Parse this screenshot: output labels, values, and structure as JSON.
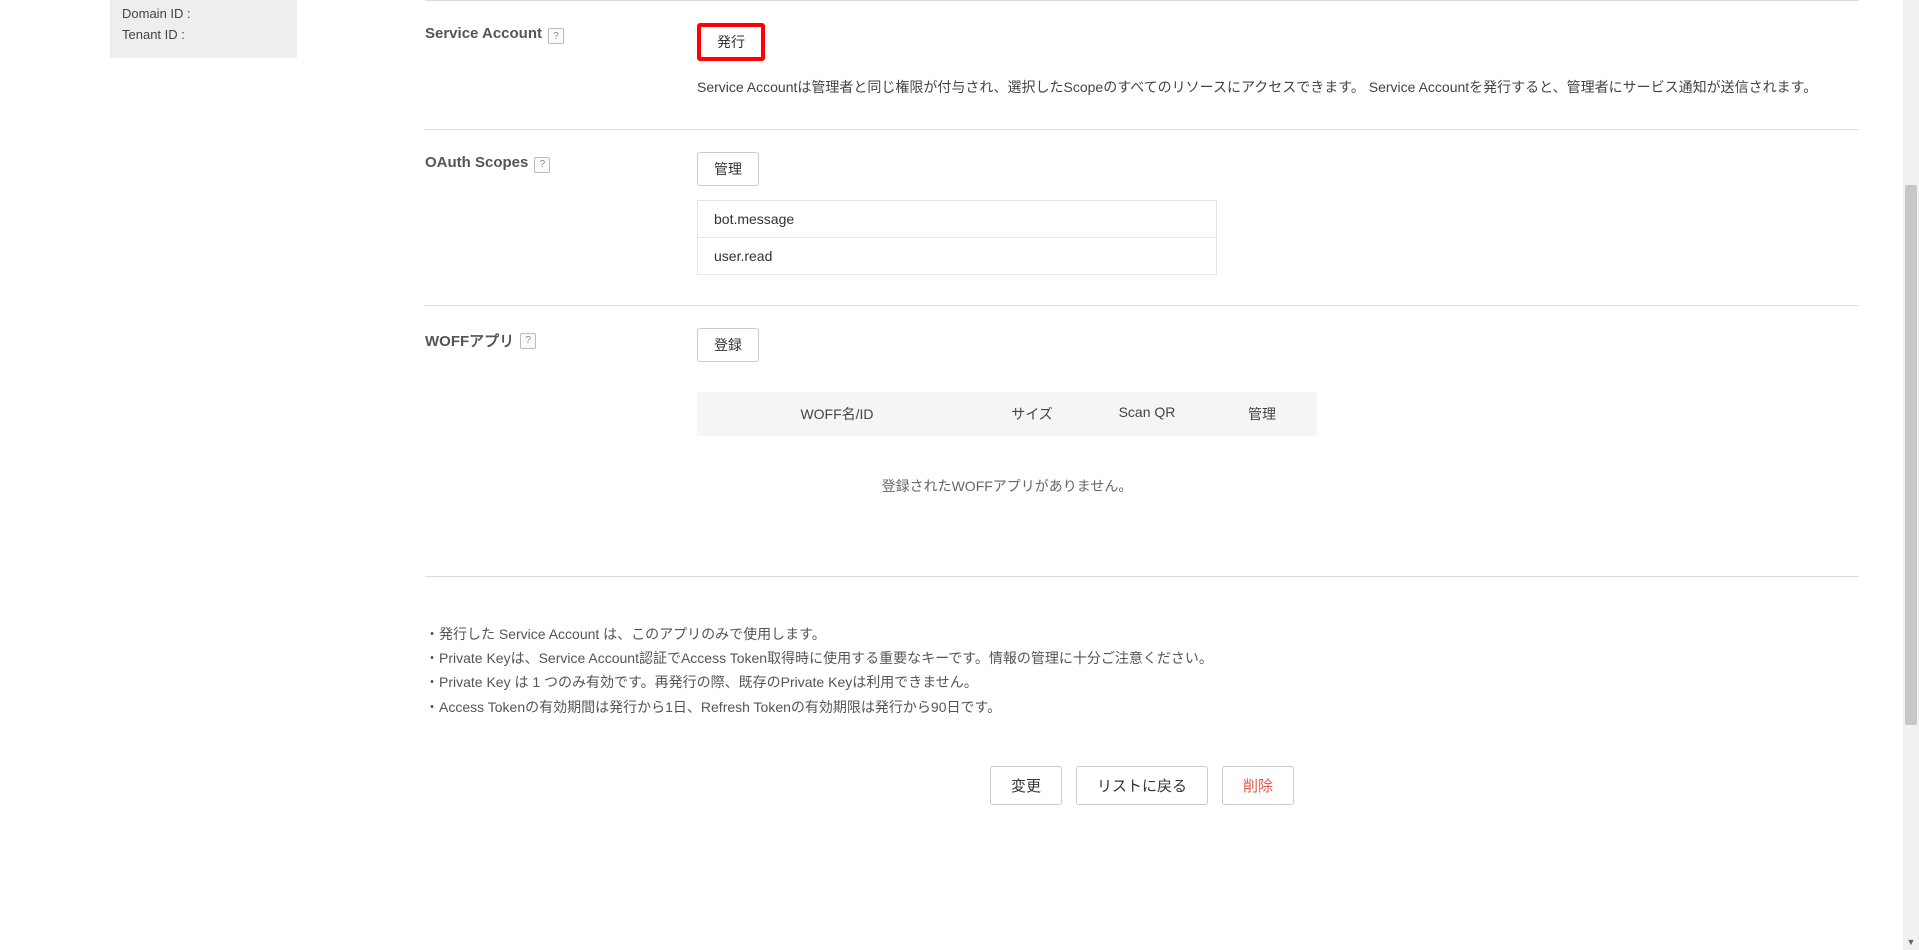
{
  "sidebar": {
    "domain_id_label": "Domain ID :",
    "tenant_id_label": "Tenant ID :"
  },
  "help_glyph": "?",
  "service_account": {
    "label": "Service Account",
    "button": "発行",
    "description": "Service Accountは管理者と同じ権限が付与され、選択したScopeのすべてのリソースにアクセスできます。 Service Accountを発行すると、管理者にサービス通知が送信されます。"
  },
  "oauth_scopes": {
    "label": "OAuth Scopes",
    "button": "管理",
    "items": [
      "bot.message",
      "user.read"
    ]
  },
  "woff": {
    "label": "WOFFアプリ",
    "button": "登録",
    "columns": {
      "name": "WOFF名/ID",
      "size": "サイズ",
      "qr": "Scan QR",
      "manage": "管理"
    },
    "empty": "登録されたWOFFアプリがありません。"
  },
  "notes": [
    "・発行した Service Account は、このアプリのみで使用します。",
    "・Private Keyは、Service Account認証でAccess Token取得時に使用する重要なキーです。情報の管理に十分ご注意ください。",
    "・Private Key は 1 つのみ有効です。再発行の際、既存のPrivate Keyは利用できません。",
    "・Access Tokenの有効期間は発行から1日、Refresh Tokenの有効期限は発行から90日です。"
  ],
  "footer": {
    "change": "変更",
    "back": "リストに戻る",
    "delete": "削除"
  }
}
